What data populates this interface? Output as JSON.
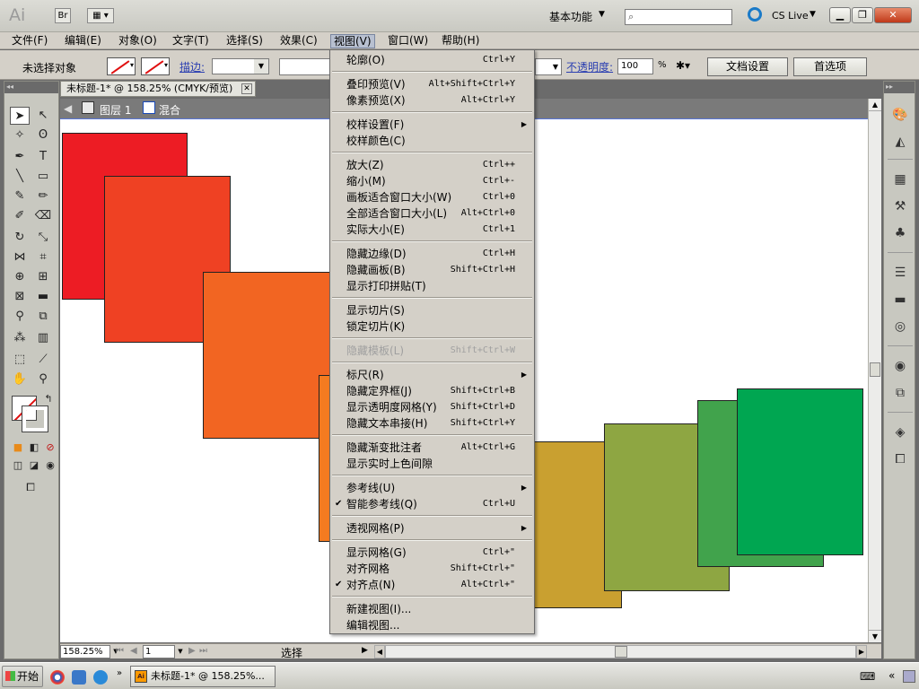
{
  "app": {
    "logo": "Ai",
    "bridge_btn": "Br",
    "workspace": "基本功能",
    "cs_live": "CS Live"
  },
  "menus": [
    "文件(F)",
    "编辑(E)",
    "对象(O)",
    "文字(T)",
    "选择(S)",
    "效果(C)",
    "视图(V)",
    "窗口(W)",
    "帮助(H)"
  ],
  "control_bar": {
    "no_selection": "未选择对象",
    "stroke_label": "描边:",
    "opacity_label": "不透明度:",
    "opacity_value": "100",
    "opacity_unit": "%",
    "doc_settings": "文档设置",
    "preferences": "首选项"
  },
  "document": {
    "tab_title": "未标题-1* @ 158.25% (CMYK/预览)",
    "layer": "图层 1",
    "group": "混合"
  },
  "colors": {
    "squares": [
      "#ed1c24",
      "#ef4123",
      "#f26522",
      "#f47b20",
      "#c9a030",
      "#8ea642",
      "#41a34c",
      "#00a651"
    ]
  },
  "view_menu": [
    {
      "label": "轮廓(O)",
      "shortcut": "Ctrl+Y"
    },
    {
      "sep": true
    },
    {
      "label": "叠印预览(V)",
      "shortcut": "Alt+Shift+Ctrl+Y"
    },
    {
      "label": "像素预览(X)",
      "shortcut": "Alt+Ctrl+Y"
    },
    {
      "sep": true
    },
    {
      "label": "校样设置(F)",
      "shortcut": "",
      "submenu": true
    },
    {
      "label": "校样颜色(C)",
      "shortcut": ""
    },
    {
      "sep": true
    },
    {
      "label": "放大(Z)",
      "shortcut": "Ctrl++"
    },
    {
      "label": "缩小(M)",
      "shortcut": "Ctrl+-"
    },
    {
      "label": "画板适合窗口大小(W)",
      "shortcut": "Ctrl+0"
    },
    {
      "label": "全部适合窗口大小(L)",
      "shortcut": "Alt+Ctrl+0"
    },
    {
      "label": "实际大小(E)",
      "shortcut": "Ctrl+1"
    },
    {
      "sep": true
    },
    {
      "label": "隐藏边缘(D)",
      "shortcut": "Ctrl+H"
    },
    {
      "label": "隐藏画板(B)",
      "shortcut": "Shift+Ctrl+H"
    },
    {
      "label": "显示打印拼贴(T)",
      "shortcut": ""
    },
    {
      "sep": true
    },
    {
      "label": "显示切片(S)",
      "shortcut": ""
    },
    {
      "label": "锁定切片(K)",
      "shortcut": ""
    },
    {
      "sep": true
    },
    {
      "label": "隐藏模板(L)",
      "shortcut": "Shift+Ctrl+W",
      "disabled": true
    },
    {
      "sep": true
    },
    {
      "label": "标尺(R)",
      "shortcut": "",
      "submenu": true
    },
    {
      "label": "隐藏定界框(J)",
      "shortcut": "Shift+Ctrl+B"
    },
    {
      "label": "显示透明度网格(Y)",
      "shortcut": "Shift+Ctrl+D"
    },
    {
      "label": "隐藏文本串接(H)",
      "shortcut": "Shift+Ctrl+Y"
    },
    {
      "sep": true
    },
    {
      "label": "隐藏渐变批注者",
      "shortcut": "Alt+Ctrl+G"
    },
    {
      "label": "显示实时上色间隙",
      "shortcut": ""
    },
    {
      "sep": true
    },
    {
      "label": "参考线(U)",
      "shortcut": "",
      "submenu": true
    },
    {
      "label": "智能参考线(Q)",
      "shortcut": "Ctrl+U",
      "checked": true
    },
    {
      "sep": true
    },
    {
      "label": "透视网格(P)",
      "shortcut": "",
      "submenu": true
    },
    {
      "sep": true
    },
    {
      "label": "显示网格(G)",
      "shortcut": "Ctrl+\""
    },
    {
      "label": "对齐网格",
      "shortcut": "Shift+Ctrl+\""
    },
    {
      "label": "对齐点(N)",
      "shortcut": "Alt+Ctrl+\"",
      "checked": true
    },
    {
      "sep": true
    },
    {
      "label": "新建视图(I)...",
      "shortcut": ""
    },
    {
      "label": "编辑视图...",
      "shortcut": ""
    }
  ],
  "status_bar": {
    "zoom": "158.25%",
    "artboard": "1",
    "status": "选择"
  },
  "taskbar": {
    "start": "开始",
    "task": "未标题-1* @ 158.25%..."
  }
}
